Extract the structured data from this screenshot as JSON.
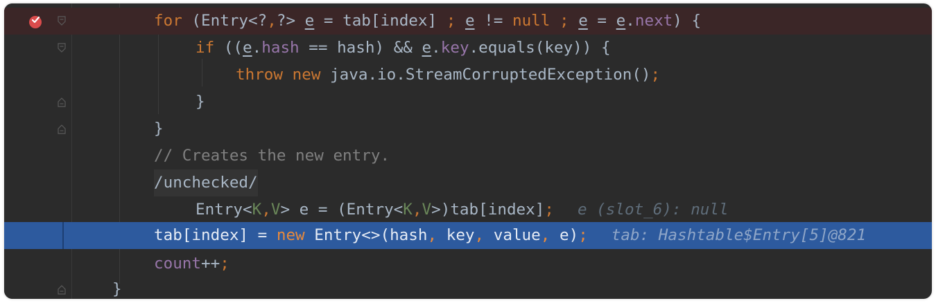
{
  "editor": {
    "theme_colors": {
      "background": "#2b2b2b",
      "breakpoint_line": "#3b2627",
      "execution_line": "#2d5a9e",
      "keyword": "#cc7832",
      "field": "#9876aa",
      "comment": "#808080",
      "breakpoint": "#db4c4c"
    },
    "breakpoint_icon": "breakpoint-check-icon",
    "fold_icons": [
      "fold-arrow-icon",
      "fold-arrow-icon",
      "fold-end-icon",
      "fold-end-icon",
      "fold-end-icon"
    ],
    "lines": [
      {
        "tokens": [
          "for",
          " (Entry<?",
          ",",
          "?> ",
          "e",
          " = tab[index] ",
          ";",
          " ",
          "e",
          " != ",
          "null",
          " ",
          ";",
          " ",
          "e",
          " = ",
          "e",
          ".",
          "next",
          ") {"
        ]
      },
      {
        "tokens": [
          "if",
          " ((",
          "e",
          ".",
          "hash",
          " == hash) && ",
          "e",
          ".",
          "key",
          ".equals(key)) {"
        ]
      },
      {
        "tokens": [
          "throw",
          " ",
          "new",
          " java.io.StreamCorruptedException()",
          ";"
        ]
      },
      {
        "tokens": [
          "}"
        ]
      },
      {
        "tokens": [
          "}"
        ]
      },
      {
        "tokens": [
          "// Creates the new entry."
        ]
      },
      {
        "tokens": [
          "/unchecked/"
        ]
      },
      {
        "tokens": [
          "Entry<",
          "K",
          ",",
          "V",
          "> e = (Entry<",
          "K",
          ",",
          "V",
          ">)tab[index]",
          ";"
        ],
        "hint": "e (slot_6): null"
      },
      {
        "tokens": [
          "tab[index] = ",
          "new",
          " Entry<>(hash",
          ",",
          " key",
          ",",
          " value",
          ",",
          " e)",
          ";"
        ],
        "hint": "tab: Hashtable$Entry[5]@821"
      },
      {
        "tokens": [
          "count",
          "++",
          ";"
        ]
      },
      {
        "tokens": [
          "}"
        ]
      }
    ]
  }
}
